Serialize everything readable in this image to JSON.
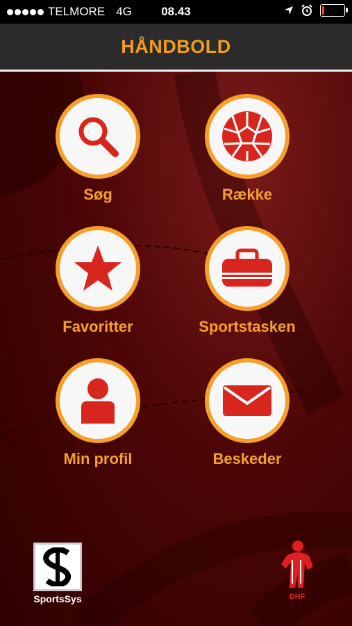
{
  "status_bar": {
    "carrier": "TELMORE",
    "network": "4G",
    "time": "08.43",
    "battery_level": 0.12
  },
  "header": {
    "title": "HÅNDBOLD"
  },
  "menu": [
    {
      "label": "Søg",
      "icon": "search-icon"
    },
    {
      "label": "Række",
      "icon": "handball-icon"
    },
    {
      "label": "Favoritter",
      "icon": "star-icon"
    },
    {
      "label": "Sportstasken",
      "icon": "sports-bag-icon"
    },
    {
      "label": "Min profil",
      "icon": "person-icon"
    },
    {
      "label": "Beskeder",
      "icon": "envelope-icon"
    }
  ],
  "footer": {
    "sportssys_label": "SportsSys",
    "dhf_label": "DHF"
  },
  "colors": {
    "accent": "#f5a02a",
    "icon_red": "#d8261e",
    "header_bg": "#2b2b2b",
    "background": "#4d0606"
  }
}
